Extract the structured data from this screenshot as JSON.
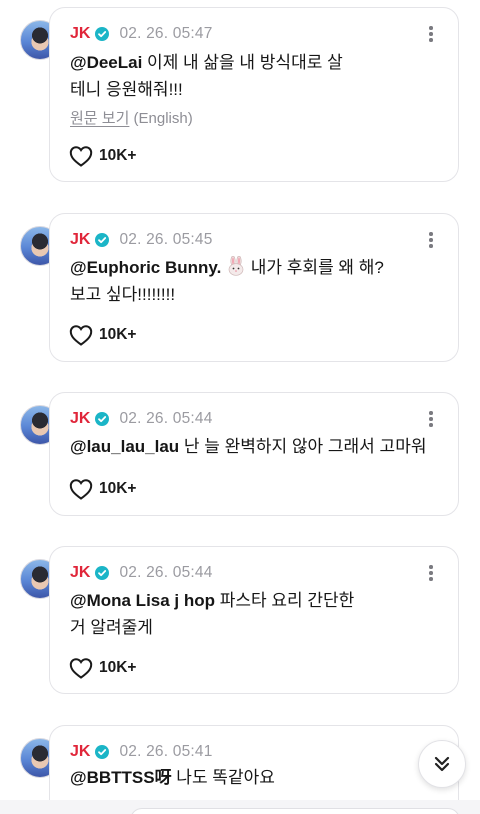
{
  "colors": {
    "author": "#e0263a",
    "verified": "#1bb5c7",
    "timestamp": "#9b9ba1"
  },
  "icons": {
    "verified": "verified-badge-icon",
    "more": "more-vertical-icon",
    "like": "heart-icon",
    "scroll": "chevron-double-down-icon",
    "emoji": "rabbit-face-emoji"
  },
  "posts": [
    {
      "author": "JK",
      "time": "02. 26. 05:47",
      "mention": "@DeeLai",
      "line1": " 이제 내 삶을 내 방식대로 살",
      "line2": "테니 응원해줘!!!",
      "translate_link": "원문 보기",
      "translate_lang": " (English)",
      "likes": "10K+"
    },
    {
      "author": "JK",
      "time": "02. 26. 05:45",
      "mention": "@Euphoric Bunny.",
      "line1": " 내가 후회를 왜 해?",
      "line2": "보고 싶다!!!!!!!!",
      "likes": "10K+"
    },
    {
      "author": "JK",
      "time": "02. 26. 05:44",
      "mention": "@lau_lau_lau",
      "line1": " 난 늘 완벽하지 않아 그래서 고마워",
      "likes": "10K+"
    },
    {
      "author": "JK",
      "time": "02. 26. 05:44",
      "mention": "@Mona Lisa j hop",
      "line1": " 파스타 요리 간단한",
      "line2": "거 알려줄게",
      "likes": "10K+"
    },
    {
      "author": "JK",
      "time": "02. 26. 05:41",
      "mention": "@BBTTSS呀",
      "line1": " 나도 똑같아요"
    }
  ]
}
